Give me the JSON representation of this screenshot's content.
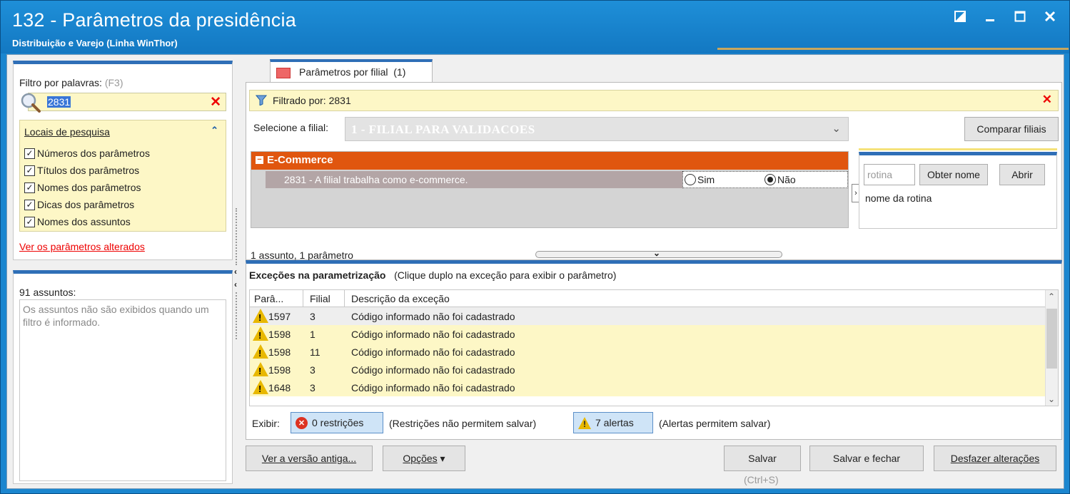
{
  "window": {
    "title": "132 - Parâmetros da presidência",
    "subtitle": "Distribuição e Varejo (Linha WinThor)",
    "controls": [
      "restore",
      "minimize",
      "maximize",
      "close"
    ]
  },
  "left": {
    "filter_label": "Filtro por palavras:",
    "filter_hint": "(F3)",
    "search_value": "2831",
    "locais_title": "Locais de pesquisa",
    "locais": [
      {
        "label": "Números dos parâmetros",
        "checked": true
      },
      {
        "label": "Títulos dos parâmetros",
        "checked": true
      },
      {
        "label": "Nomes dos parâmetros",
        "checked": true
      },
      {
        "label": "Dicas dos parâmetros",
        "checked": true
      },
      {
        "label": "Nomes dos assuntos",
        "checked": true
      }
    ],
    "changed_link": "Ver os parâmetros alterados",
    "subjects_count": "91 assuntos:",
    "subjects_info": "Os assuntos não são exibidos quando um filtro é informado."
  },
  "tab": {
    "label": "Parâmetros por filial",
    "count": "(1)"
  },
  "filter_bar": {
    "text": "Filtrado por: 2831"
  },
  "branch": {
    "label": "Selecione a filial:",
    "value": "1 - FILIAL PARA VALIDACOES",
    "compare_button": "Comparar filiais"
  },
  "group": {
    "title": "E-Commerce",
    "param_text": "2831 - A filial trabalha como e-commerce.",
    "options": [
      {
        "label": "Sim",
        "selected": false
      },
      {
        "label": "Não",
        "selected": true
      }
    ]
  },
  "routine": {
    "placeholder": "rotina",
    "get_name_button": "Obter nome",
    "open_button": "Abrir",
    "name_label": "nome da rotina"
  },
  "summary": "1 assunto, 1 parâmetro",
  "exceptions": {
    "title": "Exceções na parametrização",
    "hint": "(Clique duplo na exceção para exibir o parâmetro)",
    "columns": [
      "Parâ...",
      "Filial",
      "Descrição da exceção"
    ],
    "rows": [
      {
        "param": "1597",
        "filial": "3",
        "desc": "Código informado não foi cadastrado"
      },
      {
        "param": "1598",
        "filial": "1",
        "desc": "Código informado não foi cadastrado"
      },
      {
        "param": "1598",
        "filial": "11",
        "desc": "Código informado não foi cadastrado"
      },
      {
        "param": "1598",
        "filial": "3",
        "desc": "Código informado não foi cadastrado"
      },
      {
        "param": "1648",
        "filial": "3",
        "desc": "Código informado não foi cadastrado"
      }
    ],
    "show_label": "Exibir:",
    "restrictions_button": "0 restrições",
    "restrictions_note": "(Restrições não permitem salvar)",
    "alerts_button": "7 alertas",
    "alerts_note": "(Alertas permitem salvar)"
  },
  "footer": {
    "old_version": "Ver a versão antiga...",
    "options": "Opções",
    "save": "Salvar",
    "save_shortcut": "(Ctrl+S)",
    "save_close": "Salvar e fechar",
    "undo": "Desfazer alterações"
  },
  "colors": {
    "accent": "#2f6fb7",
    "group_header": "#e0560f",
    "highlight": "#fdf7c6",
    "title_bar": "#1b86cf"
  }
}
